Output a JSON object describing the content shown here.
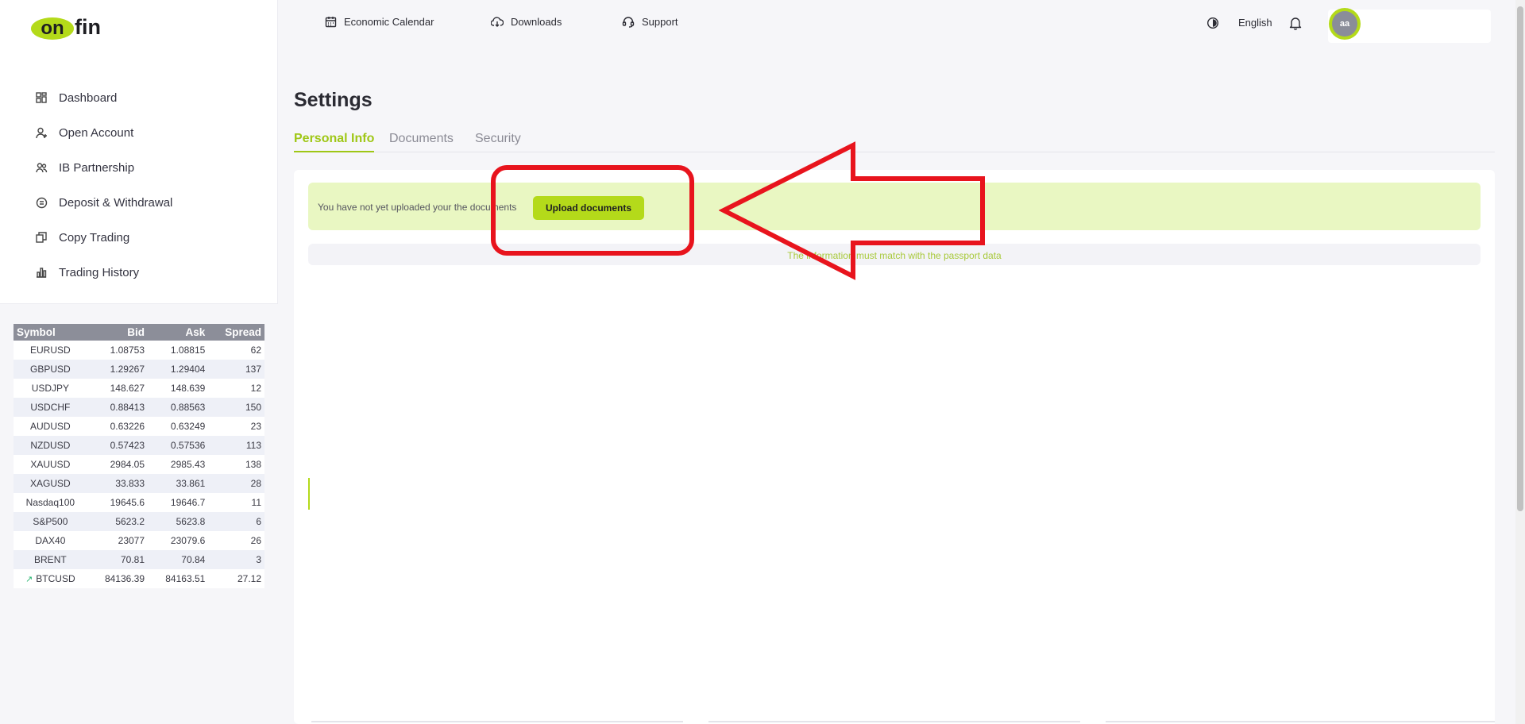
{
  "brand": {
    "logo_left": "on",
    "logo_right": "fin",
    "accent": "#b4da1a"
  },
  "sidebar": {
    "items": [
      {
        "label": "Dashboard",
        "icon": "dashboard-grid-icon"
      },
      {
        "label": "Open Account",
        "icon": "user-plus-icon"
      },
      {
        "label": "IB Partnership",
        "icon": "users-icon"
      },
      {
        "label": "Deposit & Withdrawal",
        "icon": "coin-icon"
      },
      {
        "label": "Copy Trading",
        "icon": "copy-icon"
      },
      {
        "label": "Trading History",
        "icon": "bar-chart-icon"
      }
    ]
  },
  "quotes": {
    "headers": {
      "symbol": "Symbol",
      "bid": "Bid",
      "ask": "Ask",
      "spread": "Spread"
    },
    "rows": [
      {
        "symbol": "EURUSD",
        "bid": "1.08753",
        "ask": "1.08815",
        "spread": "62"
      },
      {
        "symbol": "GBPUSD",
        "bid": "1.29267",
        "ask": "1.29404",
        "spread": "137"
      },
      {
        "symbol": "USDJPY",
        "bid": "148.627",
        "ask": "148.639",
        "spread": "12"
      },
      {
        "symbol": "USDCHF",
        "bid": "0.88413",
        "ask": "0.88563",
        "spread": "150"
      },
      {
        "symbol": "AUDUSD",
        "bid": "0.63226",
        "ask": "0.63249",
        "spread": "23"
      },
      {
        "symbol": "NZDUSD",
        "bid": "0.57423",
        "ask": "0.57536",
        "spread": "113"
      },
      {
        "symbol": "XAUUSD",
        "bid": "2984.05",
        "ask": "2985.43",
        "spread": "138"
      },
      {
        "symbol": "XAGUSD",
        "bid": "33.833",
        "ask": "33.861",
        "spread": "28"
      },
      {
        "symbol": "Nasdaq100",
        "bid": "19645.6",
        "ask": "19646.7",
        "spread": "11"
      },
      {
        "symbol": "S&P500",
        "bid": "5623.2",
        "ask": "5623.8",
        "spread": "6"
      },
      {
        "symbol": "DAX40",
        "bid": "23077",
        "ask": "23079.6",
        "spread": "26"
      },
      {
        "symbol": "BRENT",
        "bid": "70.81",
        "ask": "70.84",
        "spread": "3"
      },
      {
        "symbol": "BTCUSD",
        "bid": "84136.39",
        "ask": "84163.51",
        "spread": "27.12",
        "trend": "trend-up-icon"
      }
    ]
  },
  "header": {
    "links": [
      {
        "label": "Economic Calendar",
        "icon": "calendar-icon"
      },
      {
        "label": "Downloads",
        "icon": "download-icon"
      },
      {
        "label": "Support",
        "icon": "headset-icon"
      }
    ],
    "language": "English",
    "user_initials": "aa"
  },
  "main": {
    "title": "Settings",
    "tabs": [
      {
        "label": "Personal Info",
        "active": true
      },
      {
        "label": "Documents",
        "active": false
      },
      {
        "label": "Security",
        "active": false
      }
    ],
    "notice": {
      "text": "You have not yet uploaded your the documents",
      "button_label": "Upload documents"
    },
    "info_text": "The information must match with the passport data"
  },
  "annotation": {
    "color": "#e8141d"
  }
}
